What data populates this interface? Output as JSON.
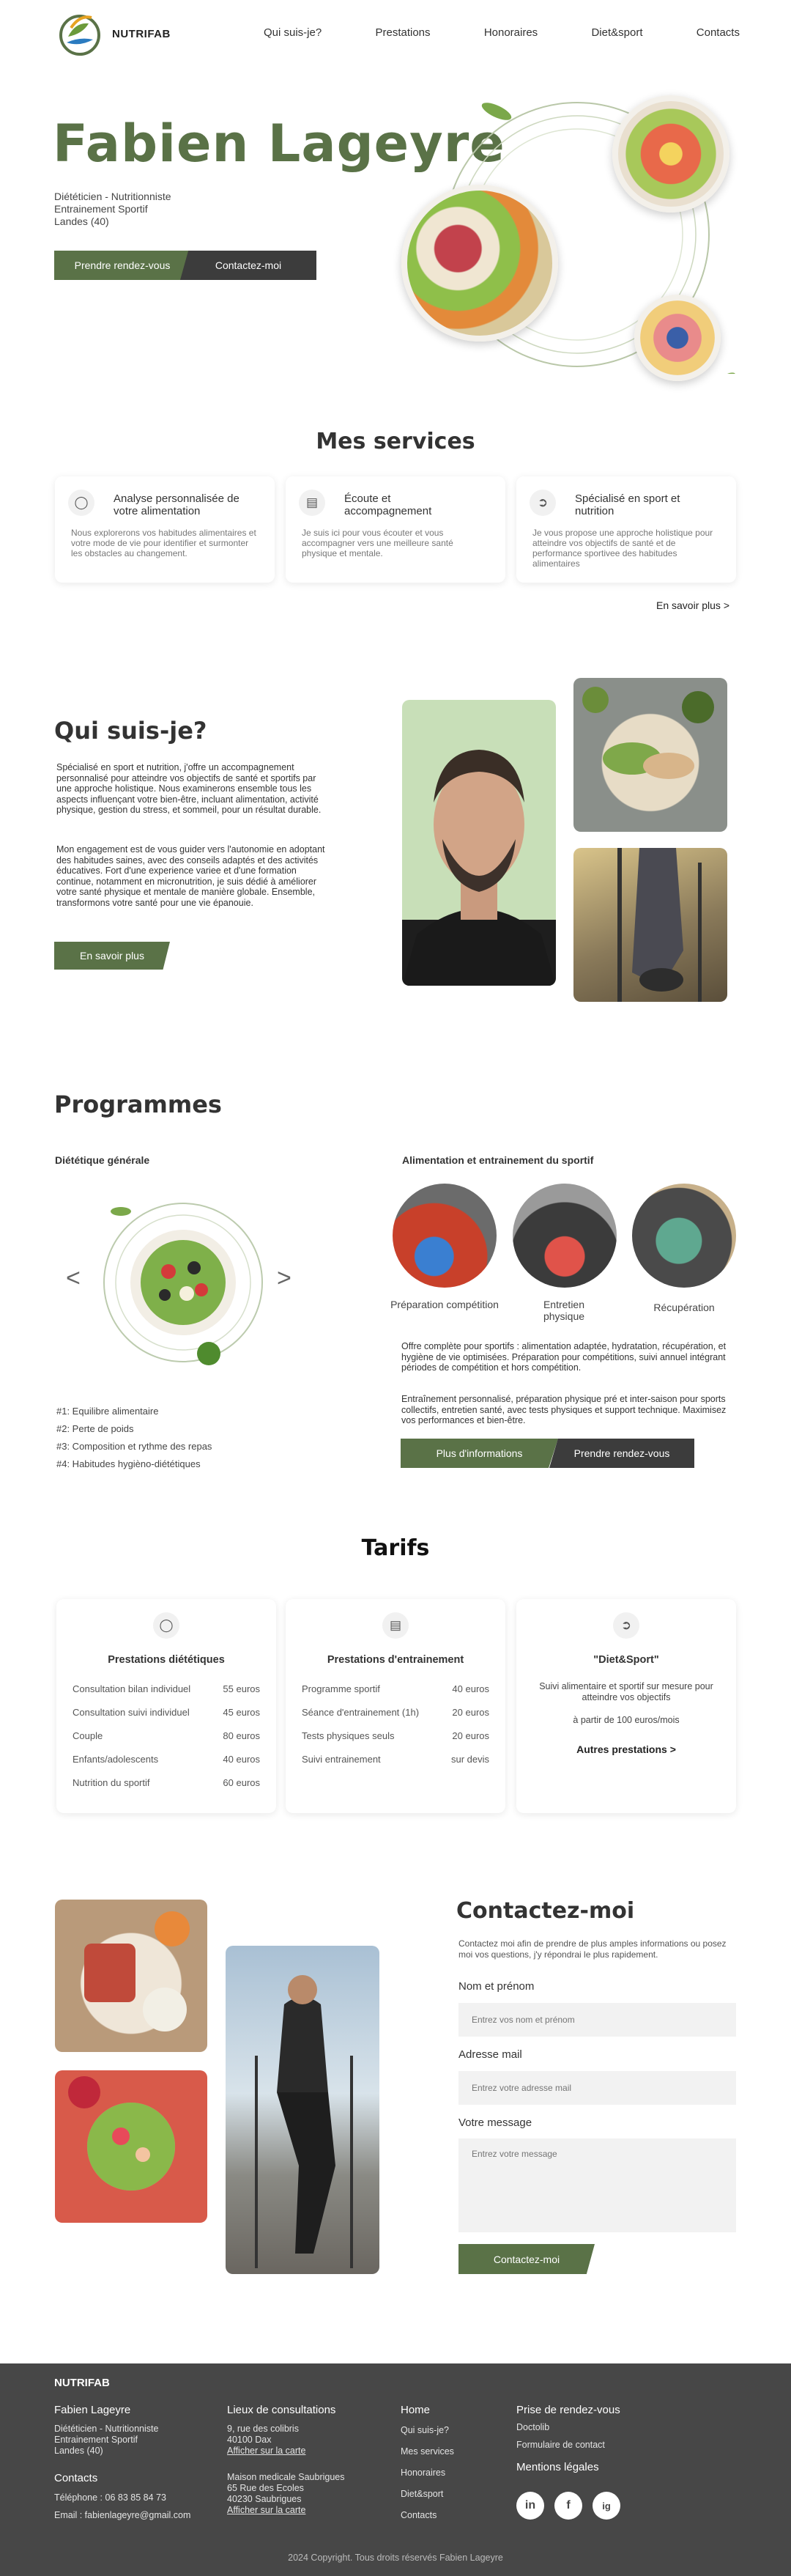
{
  "brand": {
    "name": "NUTRIFAB"
  },
  "nav": {
    "items": [
      "Qui suis-je?",
      "Prestations",
      "Honoraires",
      "Diet&sport",
      "Contacts"
    ]
  },
  "hero": {
    "title": "Fabien Lageyre",
    "lines": [
      "Diététicien - Nutritionniste",
      "Entrainement Sportif",
      "Landes (40)"
    ],
    "btn_primary": "Prendre rendez-vous",
    "btn_secondary": "Contactez-moi"
  },
  "services": {
    "title": "Mes services",
    "cards": [
      {
        "icon": "brain-icon",
        "title": "Analyse personnalisée de votre alimentation",
        "text": "Nous explorerons vos habitudes alimentaires et votre mode de vie pour identifier et surmonter les obstacles au changement."
      },
      {
        "icon": "clipboard-icon",
        "title": "Écoute et accompagnement",
        "text": "Je suis ici pour vous écouter et vous accompagner vers une meilleure santé physique et mentale."
      },
      {
        "icon": "running-shoe-icon",
        "title": "Spécialisé en sport et nutrition",
        "text": "Je vous propose une approche holistique pour atteindre vos objectifs de santé et de performance sportivee des habitudes alimentaires"
      }
    ],
    "more": "En savoir plus >"
  },
  "about": {
    "title": "Qui suis-je?",
    "p1": "Spécialisé en sport et nutrition, j'offre un accompagnement personnalisé pour atteindre vos objectifs de santé et sportifs par une approche holistique. Nous examinerons ensemble tous les aspects influençant votre bien-être, incluant alimentation, activité physique, gestion du stress, et sommeil, pour un résultat durable.",
    "p2": "Mon engagement est de vous guider vers l'autonomie en adoptant des habitudes saines, avec des conseils adaptés et des activités éducatives. Fort d'une experience variee et d'une formation continue, notamment en micronutrition, je suis dédié à améliorer votre santé physique et mentale de manière globale. Ensemble, transformons votre santé pour une vie épanouie.",
    "btn": "En savoir plus"
  },
  "programs": {
    "title": "Programmes",
    "left_title": "Diététique générale",
    "list": [
      "#1: Equilibre alimentaire",
      "#2: Perte de poids",
      "#3: Composition et rythme des repas",
      "#4: Habitudes hygièno-diététiques"
    ],
    "prev": "<",
    "next": ">",
    "right_title": "Alimentation et entrainement du sportif",
    "circles": [
      "Préparation compétition",
      "Entretien physique",
      "Récupération"
    ],
    "p1": "Offre complète pour sportifs : alimentation adaptée, hydratation, récupération, et hygiène de vie optimisées. Préparation pour compétitions, suivi annuel intégrant périodes de compétition et hors compétition.",
    "p2": "Entraînement personnalisé, préparation physique pré et inter-saison pour sports collectifs, entretien santé, avec tests physiques et support technique. Maximisez vos performances et bien-être.",
    "btn_info": "Plus d'informations",
    "btn_rdv": "Prendre rendez-vous"
  },
  "tarifs": {
    "title": "Tarifs",
    "cards": [
      {
        "icon": "brain-icon",
        "title": "Prestations diététiques",
        "rows": [
          [
            "Consultation bilan individuel",
            "55 euros"
          ],
          [
            "Consultation suivi individuel",
            "45 euros"
          ],
          [
            "Couple",
            "80 euros"
          ],
          [
            "Enfants/adolescents",
            "40 euros"
          ],
          [
            "Nutrition du sportif",
            "60 euros"
          ]
        ]
      },
      {
        "icon": "clipboard-icon",
        "title": "Prestations d'entrainement",
        "rows": [
          [
            "Programme sportif",
            "40 euros"
          ],
          [
            "Séance d'entrainement (1h)",
            "20 euros"
          ],
          [
            "Tests physiques seuls",
            "20 euros"
          ],
          [
            "Suivi entrainement",
            "sur devis"
          ]
        ]
      },
      {
        "icon": "running-shoe-icon",
        "title": "\"Diet&Sport\"",
        "text": "Suivi alimentaire et sportif sur mesure pour atteindre vos objectifs",
        "price": "à partir de 100 euros/mois",
        "more": "Autres prestations >"
      }
    ]
  },
  "contact": {
    "title": "Contactez-moi",
    "intro": "Contactez moi afin de prendre de plus amples informations ou posez moi vos questions, j'y répondrai le plus rapidement.",
    "name_label": "Nom et prénom",
    "name_placeholder": "Entrez vos nom et prénom",
    "email_label": "Adresse mail",
    "email_placeholder": "Entrez votre adresse mail",
    "msg_label": "Votre message",
    "msg_placeholder": "Entrez votre message",
    "btn": "Contactez-moi"
  },
  "footer": {
    "brand": "NUTRIFAB",
    "name": "Fabien Lageyre",
    "lines": [
      "Diététicien - Nutritionniste",
      "Entrainement Sportif",
      "Landes (40)"
    ],
    "contacts_h": "Contacts",
    "phone": "Téléphone : 06 83 85 84 73",
    "email": "Email : fabienlageyre@gmail.com",
    "lieux_h": "Lieux de consultations",
    "addr1": [
      "9, rue  des colibris",
      "40100 Dax"
    ],
    "map1": "Afficher sur la carte",
    "addr2": [
      "Maison medicale Saubrigues",
      "65 Rue des Ecoles",
      "40230 Saubrigues"
    ],
    "map2": "Afficher sur la carte",
    "links": [
      "Home",
      "Qui suis-je?",
      "Mes services",
      "Honoraires",
      "Diet&sport",
      "Contacts"
    ],
    "rdv_h": "Prise de rendez-vous",
    "rdv_links": [
      "Doctolib",
      "Formulaire de contact"
    ],
    "legal": "Mentions légales",
    "social": [
      "in",
      "f",
      "ig"
    ],
    "copyright": "2024 Copyright. Tous droits réservés Fabien Lageyre"
  }
}
